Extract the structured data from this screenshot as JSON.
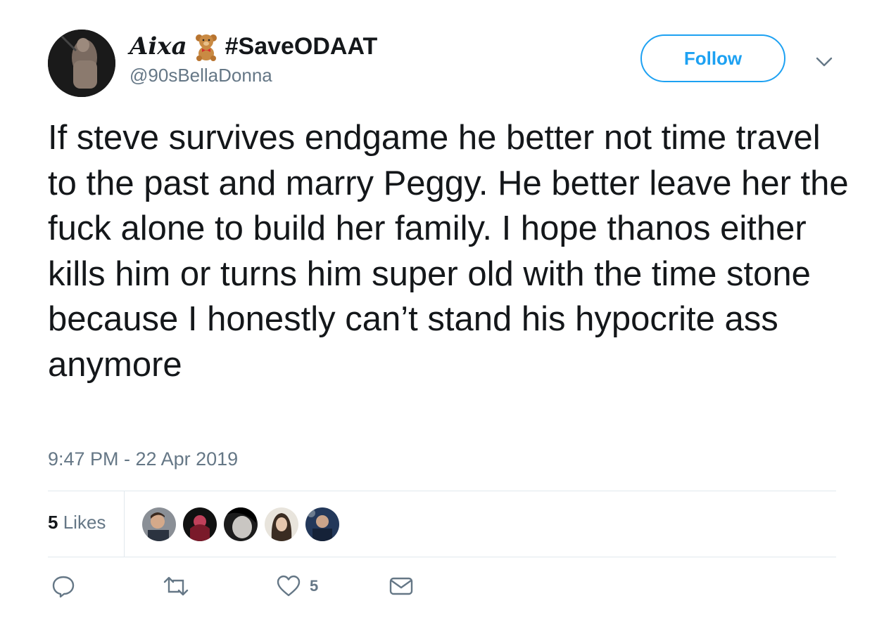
{
  "user": {
    "display_name": "Aixa",
    "name_emoji": "teddy-bear-icon",
    "hashtag": "#SaveODAAT",
    "handle": "@90sBellaDonna"
  },
  "follow_label": "Follow",
  "tweet": {
    "text": "If steve survives endgame he better not time travel to the past and marry Peggy. He better leave her the fuck alone to build her family. I hope thanos either kills him or turns him super old with the time stone because I honestly can’t stand his hypocrite ass anymore",
    "timestamp": "9:47 PM - 22 Apr 2019"
  },
  "likes": {
    "count": "5",
    "label": "Likes"
  },
  "actions": {
    "like_count": "5"
  },
  "colors": {
    "accent": "#1da1f2",
    "text": "#14171a",
    "secondary": "#657786",
    "divider": "#e1e8ed"
  }
}
